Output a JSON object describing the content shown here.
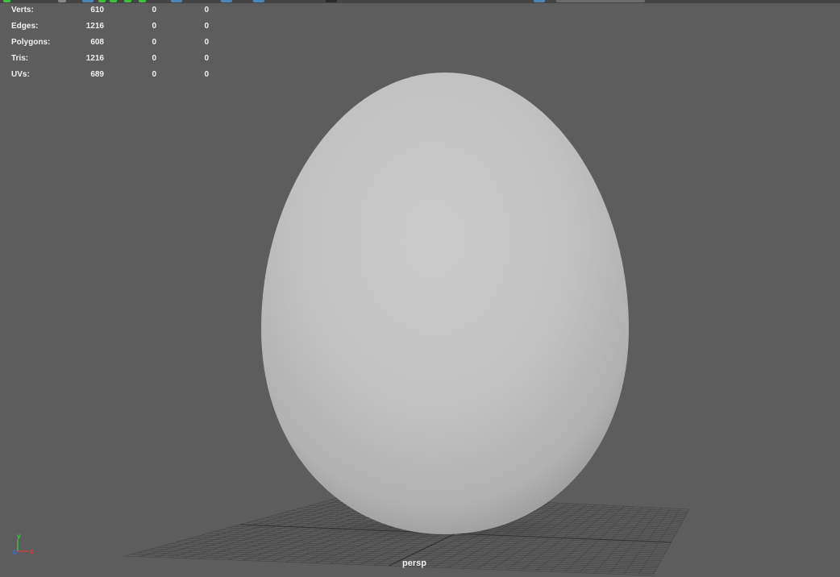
{
  "hud": {
    "rows": [
      {
        "label": "Verts:",
        "v1": "610",
        "v2": "0",
        "v3": "0"
      },
      {
        "label": "Edges:",
        "v1": "1216",
        "v2": "0",
        "v3": "0"
      },
      {
        "label": "Polygons:",
        "v1": "608",
        "v2": "0",
        "v3": "0"
      },
      {
        "label": "Tris:",
        "v1": "1216",
        "v2": "0",
        "v3": "0"
      },
      {
        "label": "UVs:",
        "v1": "689",
        "v2": "0",
        "v3": "0"
      }
    ]
  },
  "viewport": {
    "camera_name": "persp",
    "background_color": "#5d5d5d",
    "object": "egg-mesh",
    "object_color": "#c4c4c4"
  },
  "axis_gizmo": {
    "x_label": "x",
    "y_label": "y",
    "z_label": "z",
    "x_color": "#e03a3a",
    "y_color": "#3fd23f",
    "z_color": "#3a6fe0"
  }
}
